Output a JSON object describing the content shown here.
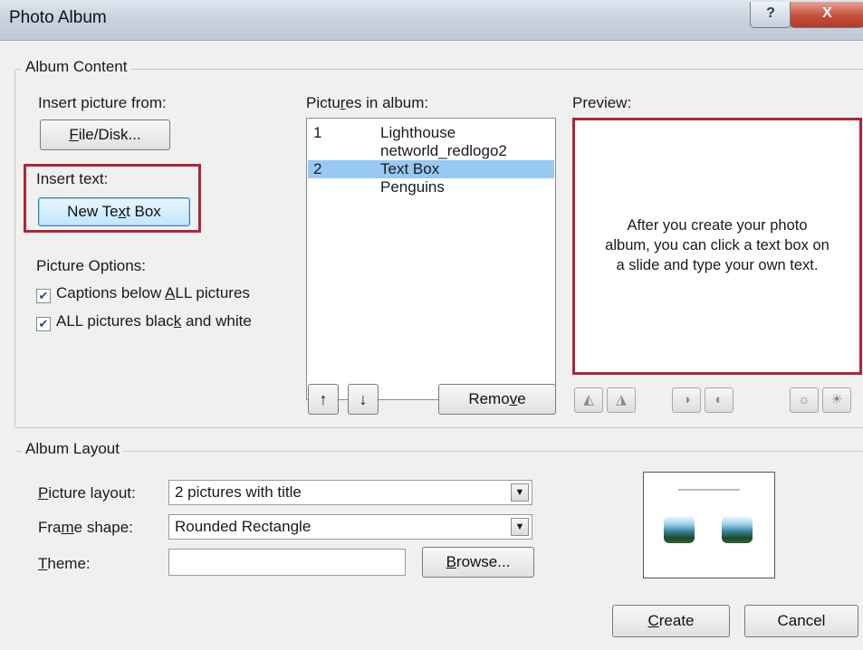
{
  "window": {
    "title": "Photo Album",
    "help_label": "?",
    "close_label": "X"
  },
  "album_content": {
    "legend": "Album Content",
    "insert_picture_label": "Insert picture from:",
    "file_disk_button": "File/Disk...",
    "insert_text_label": "Insert text:",
    "new_text_box_button": "New Text Box",
    "picture_options_label": "Picture Options:",
    "options": [
      {
        "label": "Captions below ALL pictures",
        "checked": true
      },
      {
        "label": "ALL pictures black and white",
        "checked": true
      }
    ],
    "pictures_in_album_label": "Pictures in album:",
    "pictures": [
      {
        "num": "1",
        "name": "Lighthouse",
        "selected": false
      },
      {
        "num": "",
        "name": "networld_redlogo2",
        "selected": false
      },
      {
        "num": "2",
        "name": "Text Box",
        "selected": true
      },
      {
        "num": "",
        "name": "Penguins",
        "selected": false
      }
    ],
    "move_up_label": "↑",
    "move_down_label": "↓",
    "remove_button": "Remove",
    "preview_label": "Preview:",
    "preview_text_lines": [
      "After you create your photo",
      "album, you can click a text box on",
      "a slide and type your own text."
    ]
  },
  "album_layout": {
    "legend": "Album Layout",
    "picture_layout_label": "Picture layout:",
    "picture_layout_value": "2 pictures with title",
    "frame_shape_label": "Frame shape:",
    "frame_shape_value": "Rounded Rectangle",
    "theme_label": "Theme:",
    "theme_value": "",
    "browse_button": "Browse..."
  },
  "footer": {
    "create_button": "Create",
    "cancel_button": "Cancel"
  },
  "colors": {
    "highlight_border": "#b0243a",
    "selection": "#98c8f4"
  }
}
